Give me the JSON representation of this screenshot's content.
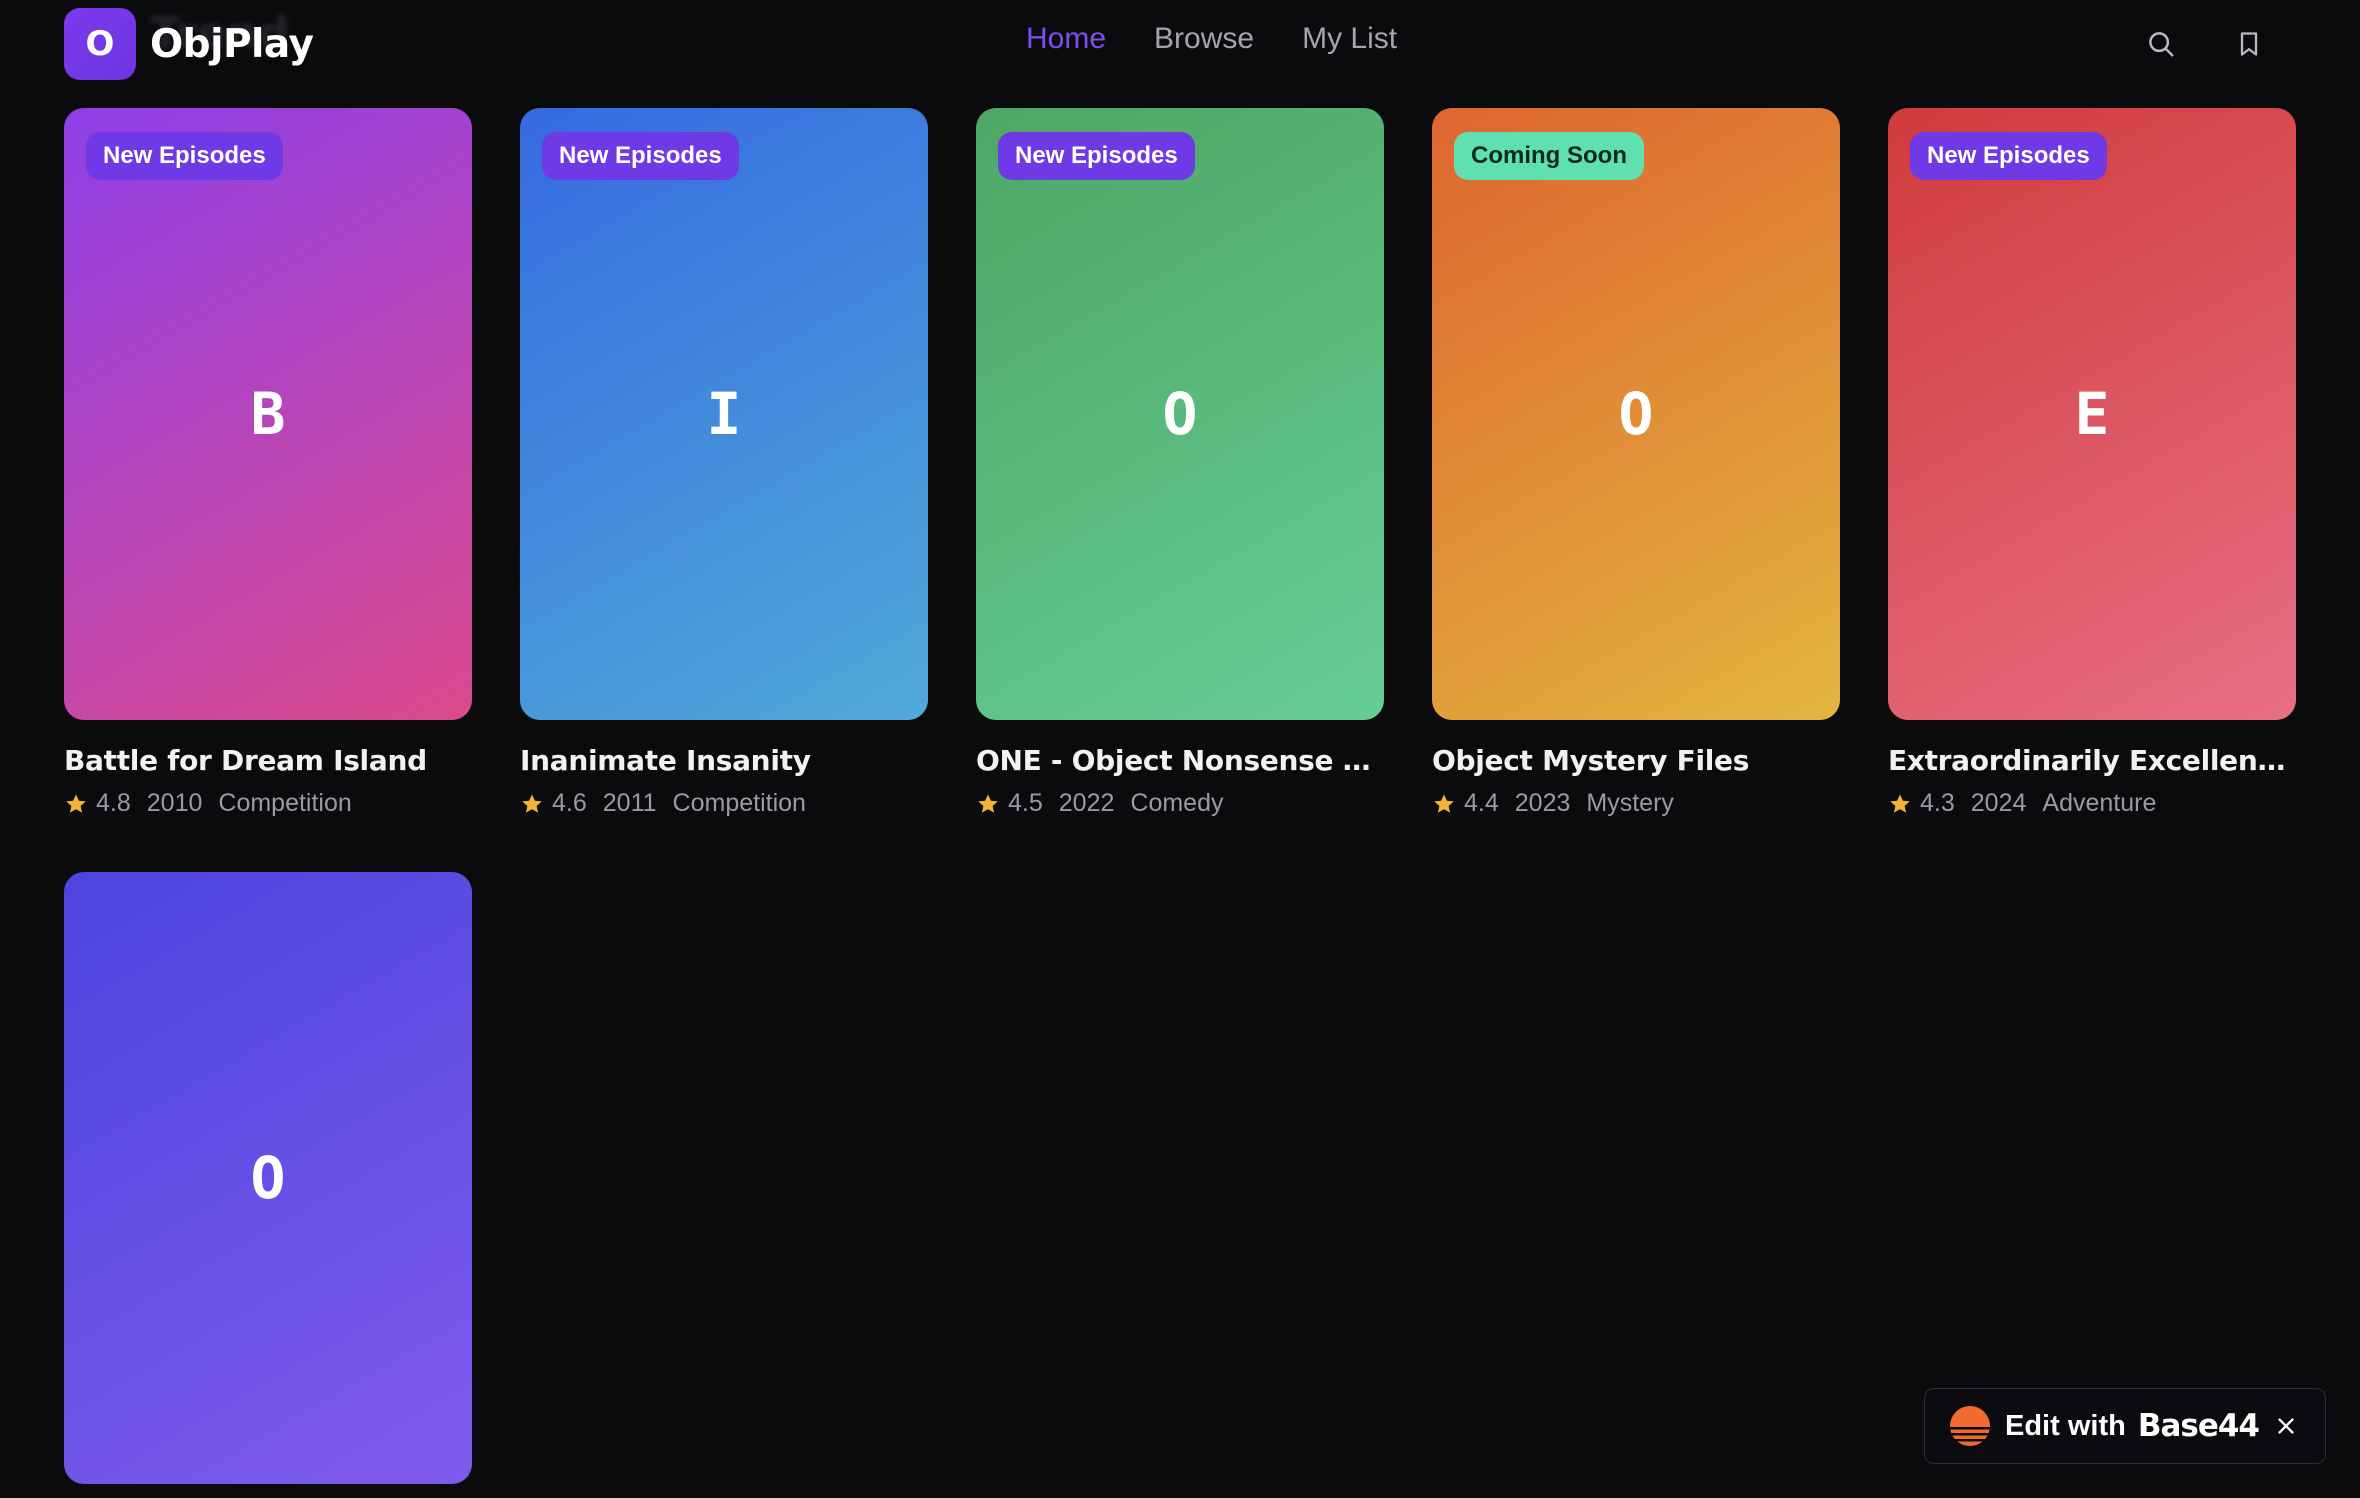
{
  "app": {
    "logo_letter": "O",
    "name": "ObjPlay",
    "ghost_heading": "Trend"
  },
  "nav": [
    {
      "label": "Home",
      "active": true
    },
    {
      "label": "Browse",
      "active": false
    },
    {
      "label": "My List",
      "active": false
    }
  ],
  "header_icons": [
    "search-icon",
    "bookmark-icon"
  ],
  "cards": [
    {
      "letter": "B",
      "badge": "New Episodes",
      "badge_type": "new",
      "title": "Battle for Dream Island",
      "rating": "4.8",
      "year": "2010",
      "genre": "Competition",
      "gradient": [
        "#8e3fe8",
        "#dc4b8c"
      ]
    },
    {
      "letter": "I",
      "badge": "New Episodes",
      "badge_type": "new",
      "title": "Inanimate Insanity",
      "rating": "4.6",
      "year": "2011",
      "genre": "Competition",
      "gradient": [
        "#356ae0",
        "#51aad8"
      ]
    },
    {
      "letter": "O",
      "badge": "New Episodes",
      "badge_type": "new",
      "title": "ONE - Object Nonsense Expl...",
      "rating": "4.5",
      "year": "2022",
      "genre": "Comedy",
      "gradient": [
        "#4ea664",
        "#66cd96"
      ]
    },
    {
      "letter": "O",
      "badge": "Coming Soon",
      "badge_type": "soon",
      "title": "Object Mystery Files",
      "rating": "4.4",
      "year": "2023",
      "genre": "Mystery",
      "gradient": [
        "#de6630",
        "#e2b53e"
      ]
    },
    {
      "letter": "E",
      "badge": "New Episodes",
      "badge_type": "new",
      "title": "Extraordinarily Excellent Ent...",
      "rating": "4.3",
      "year": "2024",
      "genre": "Adventure",
      "gradient": [
        "#cf3b3b",
        "#e87085"
      ]
    },
    {
      "letter": "O",
      "badge": "",
      "badge_type": "",
      "title": "",
      "rating": "",
      "year": "",
      "genre": "",
      "gradient": [
        "#4c45de",
        "#7f5bec"
      ]
    }
  ],
  "edit_pill": {
    "label": "Edit with",
    "brand": "Base44"
  },
  "colors": {
    "background": "#0b0b0e",
    "accent": "#7c4df0",
    "star": "#f2b531",
    "badge_new": "#6f3ae6",
    "badge_soon": "#5ee0b0"
  }
}
